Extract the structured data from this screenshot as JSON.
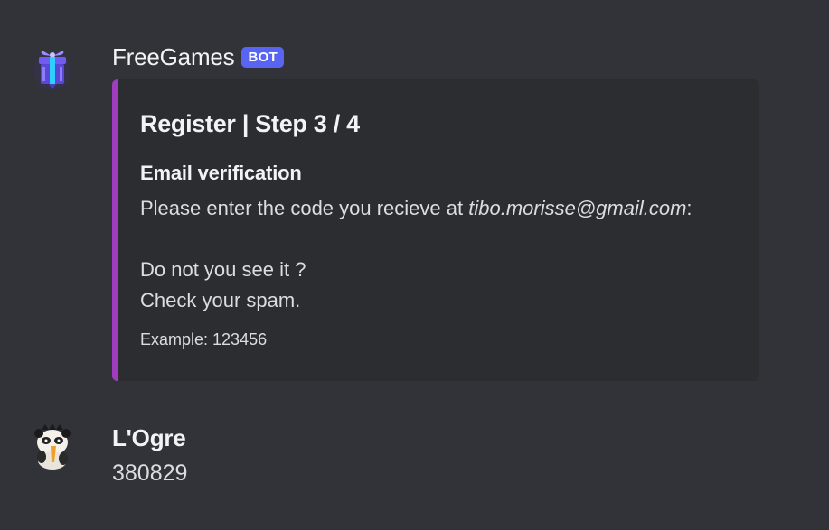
{
  "colors": {
    "background": "#313338",
    "embed_background": "#2b2d31",
    "embed_accent": "#a03dbf",
    "bot_tag": "#5865f2"
  },
  "messages": [
    {
      "author": "FreeGames",
      "tag": "BOT",
      "avatar_icon": "gift-box-icon",
      "embed": {
        "title": "Register | Step 3 / 4",
        "field_name": "Email verification",
        "line1_prefix": "Please enter the code you recieve at ",
        "line1_email": "tibo.morisse@gmail.com",
        "line1_suffix": ":",
        "line2": "Do not you see it ?",
        "line3": "Check your spam.",
        "footer": "Example: 123456"
      }
    },
    {
      "author": "L'Ogre",
      "avatar_icon": "panda-avatar-icon",
      "content": "380829"
    }
  ]
}
